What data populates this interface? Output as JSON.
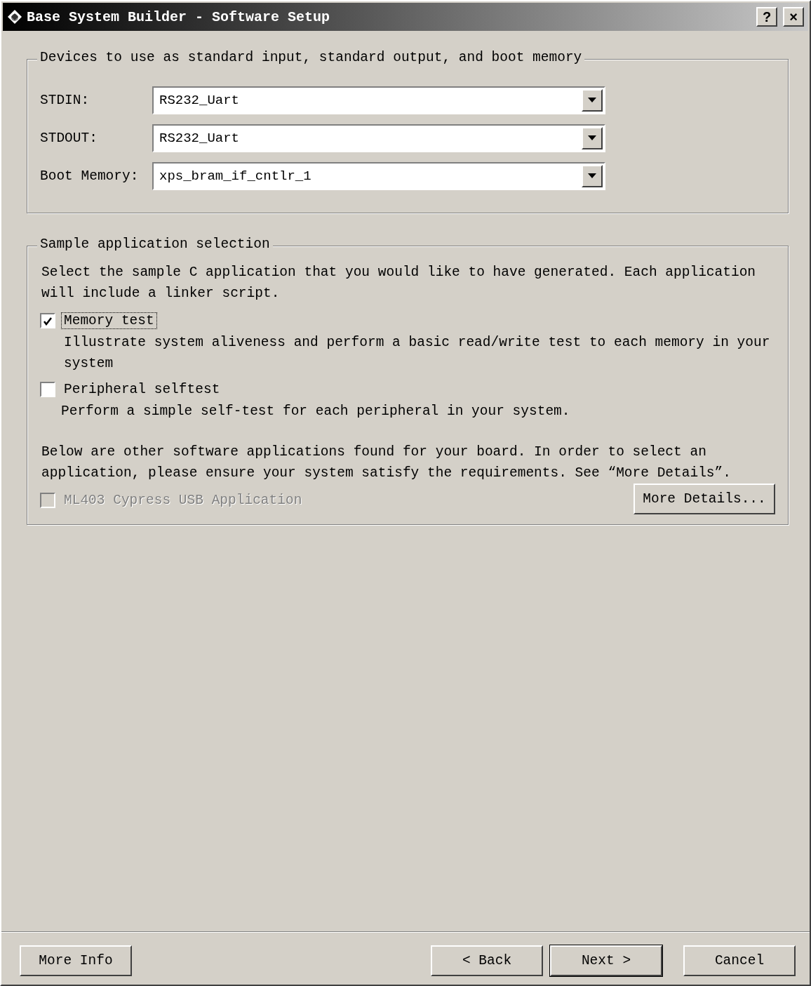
{
  "window": {
    "title": "Base System Builder - Software Setup",
    "title_buttons": [
      "?",
      "×"
    ]
  },
  "devices_group": {
    "legend": "Devices to use as standard input, standard output, and boot memory",
    "fields": [
      {
        "label": "STDIN:",
        "value": "RS232_Uart"
      },
      {
        "label": "STDOUT:",
        "value": "RS232_Uart"
      },
      {
        "label": "Boot Memory:",
        "value": "xps_bram_if_cntlr_1"
      }
    ]
  },
  "sample_group": {
    "legend": "Sample application selection",
    "intro": "Select the sample C application that you would like to have generated.  Each application will include a linker script.",
    "options": [
      {
        "label": "Memory test",
        "checked": true,
        "focused": true,
        "description": "Illustrate system aliveness and perform a basic read/write test to each memory in your system"
      },
      {
        "label": "Peripheral selftest",
        "checked": false,
        "focused": false,
        "description": "Perform a simple self-test for each peripheral in your system."
      }
    ],
    "other_text": "Below are other software applications found for your board. In order to select an application, please ensure your system satisfy the requirements.  See “More Details”.",
    "other_apps": [
      {
        "label": "ML403 Cypress USB Application",
        "checked": false,
        "disabled": true
      }
    ],
    "details_button": "More Details..."
  },
  "footer": {
    "buttons": [
      {
        "label": "More Info",
        "default": false,
        "kind": "left"
      },
      {
        "label": "< Back",
        "default": false,
        "kind": "right"
      },
      {
        "label": "Next >",
        "default": true,
        "kind": "right"
      },
      {
        "label": "Cancel",
        "default": false,
        "kind": "right"
      }
    ]
  }
}
